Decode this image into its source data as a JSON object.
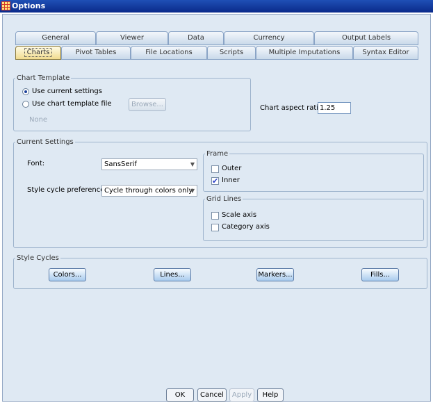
{
  "window": {
    "title": "Options"
  },
  "tabs_row1": [
    "General",
    "Viewer",
    "Data",
    "Currency",
    "Output Labels"
  ],
  "tabs_row2": [
    "Charts",
    "Pivot Tables",
    "File Locations",
    "Scripts",
    "Multiple Imputations",
    "Syntax Editor"
  ],
  "chart_template": {
    "legend": "Chart Template",
    "option_current": "Use current settings",
    "option_file": "Use chart template file",
    "browse_label": "Browse...",
    "file_value": "None",
    "selected": "current"
  },
  "aspect_ratio": {
    "label": "Chart aspect ratio:",
    "value": "1.25"
  },
  "current_settings": {
    "legend": "Current Settings",
    "font_label": "Font:",
    "font_value": "SansSerif",
    "style_label": "Style cycle preference:",
    "style_value": "Cycle through colors only"
  },
  "frame": {
    "legend": "Frame",
    "outer_label": "Outer",
    "outer_checked": false,
    "inner_label": "Inner",
    "inner_checked": true
  },
  "grid_lines": {
    "legend": "Grid Lines",
    "scale_label": "Scale axis",
    "scale_checked": false,
    "category_label": "Category axis",
    "category_checked": false
  },
  "style_cycles": {
    "legend": "Style Cycles",
    "colors": "Colors...",
    "lines": "Lines...",
    "markers": "Markers...",
    "fills": "Fills..."
  },
  "footer": {
    "ok": "OK",
    "cancel": "Cancel",
    "apply": "Apply",
    "help": "Help"
  },
  "check_mark": "✔"
}
